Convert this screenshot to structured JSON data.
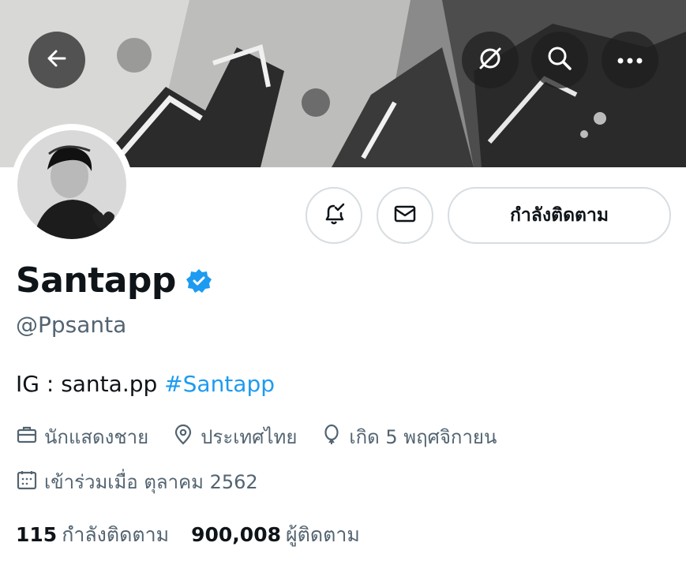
{
  "header": {
    "back_icon": "arrow-left-icon",
    "grok_icon": "grok-icon",
    "search_icon": "search-icon",
    "more_icon": "more-icon"
  },
  "actions": {
    "notify_icon": "bell-check-icon",
    "message_icon": "envelope-icon",
    "follow_label": "กำลังติดตาม"
  },
  "profile": {
    "name": "Santapp",
    "verified_icon": "verified-badge-icon",
    "handle": "@Ppsanta",
    "bio_text": "IG : santa.pp ",
    "bio_hashtag": "#Santapp",
    "occupation": "นักแสดงชาย",
    "location": "ประเทศไทย",
    "birthday": "เกิด 5 พฤศจิกายน",
    "joined": "เข้าร่วมเมื่อ ตุลาคม 2562"
  },
  "stats": {
    "following_count": "115",
    "following_label": "กำลังติดตาม",
    "followers_count": "900,008",
    "followers_label": "ผู้ติดตาม"
  },
  "colors": {
    "accent": "#1d9bf0",
    "text": "#0f1419",
    "muted": "#536471",
    "border": "#d7dde1"
  }
}
